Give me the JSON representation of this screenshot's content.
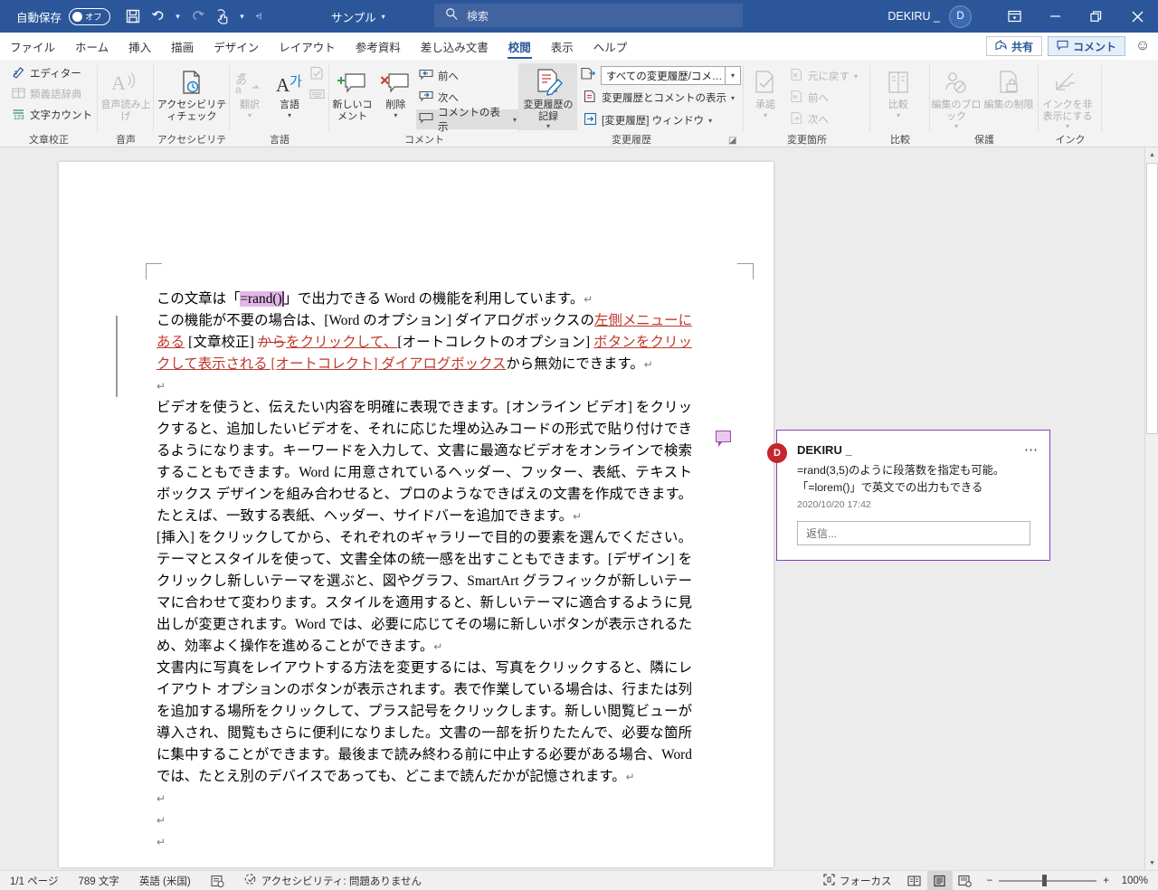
{
  "titlebar": {
    "autosave_label": "自動保存",
    "autosave_state": "オフ",
    "quick_access": [
      {
        "name": "save-icon",
        "label": "保存"
      },
      {
        "name": "undo-icon",
        "label": "元に戻す"
      },
      {
        "name": "redo-icon",
        "label": "やり直し"
      },
      {
        "name": "touch-mode-icon",
        "label": "タッチ/マウスモードの切り替え"
      },
      {
        "name": "customize-qat-icon",
        "label": "クイックアクセスツールバーのユーザー設定"
      }
    ],
    "document_name": "サンプル",
    "search_placeholder": "検索",
    "account_name": "DEKIRU _",
    "avatar_initial": "D",
    "window_buttons": {
      "ribbon_display": "リボンの表示オプション",
      "minimize": "最小化",
      "restore": "元に戻す (縮小)",
      "close": "閉じる"
    }
  },
  "tabs": [
    {
      "label": "ファイル",
      "active": false
    },
    {
      "label": "ホーム",
      "active": false
    },
    {
      "label": "挿入",
      "active": false
    },
    {
      "label": "描画",
      "active": false
    },
    {
      "label": "デザイン",
      "active": false
    },
    {
      "label": "レイアウト",
      "active": false
    },
    {
      "label": "参考資料",
      "active": false
    },
    {
      "label": "差し込み文書",
      "active": false
    },
    {
      "label": "校閲",
      "active": true
    },
    {
      "label": "表示",
      "active": false
    },
    {
      "label": "ヘルプ",
      "active": false
    }
  ],
  "tab_right": {
    "share_label": "共有",
    "comments_label": "コメント",
    "feedback_icon": "smiley-icon"
  },
  "ribbon": {
    "collapse_label": "⌃",
    "groups": [
      {
        "name": "文章校正",
        "items": [
          {
            "label": "エディター",
            "icon": "editor-icon",
            "disabled": false
          },
          {
            "label": "類義語辞典",
            "icon": "thesaurus-icon",
            "disabled": true
          },
          {
            "label": "文字カウント",
            "icon": "word-count-icon",
            "disabled": false
          }
        ]
      },
      {
        "name": "音声",
        "items": [
          {
            "label": "音声読み上げ",
            "icon": "read-aloud-icon",
            "disabled": true
          }
        ]
      },
      {
        "name": "アクセシビリティ",
        "items": [
          {
            "label": "アクセシビリティチェック",
            "icon": "accessibility-check-icon",
            "disabled": false
          }
        ]
      },
      {
        "name": "言語",
        "items": [
          {
            "label": "翻訳",
            "icon": "translate-icon",
            "disabled": true
          },
          {
            "label": "言語",
            "icon": "language-icon",
            "disabled": false
          },
          {
            "label": "言語モードの設定",
            "icon": "proofing-language-icon",
            "disabled": true
          },
          {
            "label": "入力モード",
            "icon": "keyboard-icon",
            "disabled": true
          }
        ]
      },
      {
        "name": "コメント",
        "items": [
          {
            "label": "新しいコメント",
            "icon": "new-comment-icon",
            "disabled": false
          },
          {
            "label": "削除",
            "icon": "delete-comment-icon",
            "disabled": false
          },
          {
            "label": "前へ",
            "icon": "previous-comment-icon",
            "disabled": false
          },
          {
            "label": "次へ",
            "icon": "next-comment-icon",
            "disabled": false
          },
          {
            "label": "コメントの表示",
            "icon": "show-comments-icon",
            "disabled": false,
            "highlighted": true
          }
        ]
      },
      {
        "name": "変更履歴",
        "items": [
          {
            "label": "変更履歴の記録",
            "icon": "track-changes-icon",
            "highlighted": true
          },
          {
            "label": "すべての変更履歴/コメ…",
            "icon": "display-for-review-dropdown"
          },
          {
            "label": "変更履歴とコメントの表示",
            "icon": "show-markup-icon"
          },
          {
            "label": "[変更履歴] ウィンドウ",
            "icon": "reviewing-pane-icon"
          }
        ]
      },
      {
        "name": "変更箇所",
        "items": [
          {
            "label": "承諾",
            "icon": "accept-icon",
            "disabled": true
          },
          {
            "label": "元に戻す",
            "icon": "reject-icon",
            "disabled": true
          },
          {
            "label": "前へ",
            "icon": "previous-change-icon",
            "disabled": true
          },
          {
            "label": "次へ",
            "icon": "next-change-icon",
            "disabled": true
          }
        ]
      },
      {
        "name": "比較",
        "items": [
          {
            "label": "比較",
            "icon": "compare-icon",
            "disabled": true
          }
        ]
      },
      {
        "name": "保護",
        "items": [
          {
            "label": "編集のブロック",
            "icon": "block-authors-icon",
            "disabled": true
          },
          {
            "label": "編集の制限",
            "icon": "restrict-editing-icon",
            "disabled": true
          }
        ]
      },
      {
        "name": "インク",
        "items": [
          {
            "label": "インクを非表示にする",
            "icon": "hide-ink-icon",
            "disabled": true
          }
        ]
      }
    ]
  },
  "document": {
    "paragraphs": [
      {
        "id": "p1",
        "runs": [
          {
            "text": "この文章は「",
            "type": "normal"
          },
          {
            "text": "=rand()",
            "type": "field"
          },
          {
            "text": "」で出力できる Word の機能を利用しています。",
            "type": "normal"
          },
          {
            "text": "↵",
            "type": "pilcrow"
          }
        ]
      },
      {
        "id": "p2",
        "runs": [
          {
            "text": "この機能が不要の場合は、[Word のオプション] ダイアログボックスの",
            "type": "normal"
          },
          {
            "text": "左側メニューにある",
            "type": "inserted"
          },
          {
            "text": " [文章校正] ",
            "type": "normal"
          },
          {
            "text": "から",
            "type": "deleted"
          },
          {
            "text": "をクリックして、",
            "type": "inserted"
          },
          {
            "text": "[オートコレクトのオプション] ",
            "type": "normal"
          },
          {
            "text": "ボタンをクリックして表示される [オートコレクト] ダイアログボックス",
            "type": "inserted"
          },
          {
            "text": "から無効にできます。",
            "type": "normal"
          },
          {
            "text": "↵",
            "type": "pilcrow"
          }
        ]
      },
      {
        "id": "p3",
        "runs": [
          {
            "text": "↵",
            "type": "pilcrow"
          }
        ]
      },
      {
        "id": "p4",
        "runs": [
          {
            "text": "ビデオを使うと、伝えたい内容を明確に表現できます。[オンライン ビデオ] をクリックすると、追加したいビデオを、それに応じた埋め込みコードの形式で貼り付けできるようになります。キーワードを入力して、文書に最適なビデオをオンラインで検索することもできます。Word に用意されているヘッダー、フッター、表紙、テキスト ボックス デザインを組み合わせると、プロのようなできばえの文書を作成できます。たとえば、一致する表紙、ヘッダー、サイドバーを追加できます。",
            "type": "normal"
          },
          {
            "text": "↵",
            "type": "pilcrow"
          }
        ]
      },
      {
        "id": "p5",
        "runs": [
          {
            "text": "[挿入] をクリックしてから、それぞれのギャラリーで目的の要素を選んでください。テーマとスタイルを使って、文書全体の統一感を出すこともできます。[デザイン] をクリックし新しいテーマを選ぶと、図やグラフ、SmartArt グラフィックが新しいテーマに合わせて変わります。スタイルを適用すると、新しいテーマに適合するように見出しが変更されます。Word では、必要に応じてその場に新しいボタンが表示されるため、効率よく操作を進めることができます。",
            "type": "normal"
          },
          {
            "text": "↵",
            "type": "pilcrow"
          }
        ]
      },
      {
        "id": "p6",
        "runs": [
          {
            "text": "文書内に写真をレイアウトする方法を変更するには、写真をクリックすると、隣にレイアウト オプションのボタンが表示されます。表で作業している場合は、行または列を追加する場所をクリックして、プラス記号をクリックします。新しい閲覧ビューが導入され、閲覧もさらに便利になりました。文書の一部を折りたたんで、必要な箇所に集中することができます。最後まで読み終わる前に中止する必要がある場合、Word では、たとえ別のデバイスであっても、どこまで読んだかが記憶されます。",
            "type": "normal"
          },
          {
            "text": "↵",
            "type": "pilcrow"
          }
        ]
      },
      {
        "id": "p7",
        "runs": [
          {
            "text": "↵",
            "type": "pilcrow"
          }
        ]
      },
      {
        "id": "p8",
        "runs": [
          {
            "text": "↵",
            "type": "pilcrow"
          }
        ]
      },
      {
        "id": "p9",
        "runs": [
          {
            "text": "↵",
            "type": "pilcrow"
          }
        ]
      }
    ]
  },
  "comment": {
    "avatar_initial": "D",
    "author": "DEKIRU _",
    "more_label": "⋯",
    "body": "=rand(3,5)のように段落数を指定も可能。「=lorem()」で英文での出力もできる",
    "timestamp": "2020/10/20 17:42",
    "reply_placeholder": "返信..."
  },
  "statusbar": {
    "page_info": "1/1 ページ",
    "word_count": "789 文字",
    "language": "英語 (米国)",
    "proofing_icon": "proofing-status-icon",
    "accessibility": "アクセシビリティ: 問題ありません",
    "focus_label": "フォーカス",
    "views": [
      {
        "name": "read-mode-icon",
        "active": false
      },
      {
        "name": "print-layout-icon",
        "active": true
      },
      {
        "name": "web-layout-icon",
        "active": false
      }
    ],
    "zoom_out": "−",
    "zoom_in": "+",
    "zoom_level": "100%"
  },
  "colors": {
    "titlebar": "#2b579a",
    "accent": "#2b579a",
    "comment_border": "#8c40b3",
    "avatar_red": "#c4262e",
    "revision_red": "#c0392b",
    "field_highlight": "#e3b6e8"
  }
}
